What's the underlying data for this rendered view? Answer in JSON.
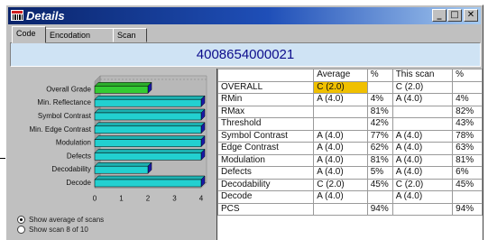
{
  "window": {
    "title": "Details",
    "buttons": {
      "minimize": "_",
      "maximize": "□",
      "close": "✕"
    }
  },
  "tabs": [
    {
      "label": "Code",
      "active": true
    },
    {
      "label": "Encodation",
      "active": false
    },
    {
      "label": "Scan",
      "active": false
    }
  ],
  "barcode_value": "4008654000021",
  "chart_data": {
    "type": "bar",
    "orientation": "horizontal",
    "style": "3d",
    "categories": [
      "Overall Grade",
      "Min. Reflectance",
      "Symbol Contrast",
      "Min. Edge Contrast",
      "Modulation",
      "Defects",
      "Decodability",
      "Decode"
    ],
    "values": [
      2,
      4,
      4,
      4,
      4,
      4,
      2,
      4
    ],
    "bar_colors": [
      "#33cc33",
      "#22d0d0",
      "#22d0d0",
      "#22d0d0",
      "#22d0d0",
      "#22d0d0",
      "#22d0d0",
      "#22d0d0"
    ],
    "xlim": [
      0,
      4
    ],
    "xticks": [
      "0",
      "1",
      "2",
      "3",
      "4"
    ],
    "title": "",
    "xlabel": "",
    "ylabel": ""
  },
  "scan_options": [
    {
      "label": "Show average of scans",
      "selected": true
    },
    {
      "label": "Show scan 8 of 10",
      "selected": false
    }
  ],
  "grid": {
    "headers": [
      "",
      "Average",
      "%",
      "This scan",
      "%"
    ],
    "rows": [
      {
        "name": "OVERALL",
        "avg": "C (2.0)",
        "pct1": "",
        "this": "C (2.0)",
        "pct2": "",
        "highlight": true
      },
      {
        "name": "RMin",
        "avg": "A (4.0)",
        "pct1": "4%",
        "this": "A (4.0)",
        "pct2": "4%"
      },
      {
        "name": "RMax",
        "avg": "",
        "pct1": "81%",
        "this": "",
        "pct2": "82%"
      },
      {
        "name": "Threshold",
        "avg": "",
        "pct1": "42%",
        "this": "",
        "pct2": "43%"
      },
      {
        "name": "Symbol Contrast",
        "avg": "A (4.0)",
        "pct1": "77%",
        "this": "A (4.0)",
        "pct2": "78%"
      },
      {
        "name": "Edge Contrast",
        "avg": "A (4.0)",
        "pct1": "62%",
        "this": "A (4.0)",
        "pct2": "63%"
      },
      {
        "name": "Modulation",
        "avg": "A (4.0)",
        "pct1": "81%",
        "this": "A (4.0)",
        "pct2": "81%"
      },
      {
        "name": "Defects",
        "avg": "A (4.0)",
        "pct1": "5%",
        "this": "A (4.0)",
        "pct2": "6%"
      },
      {
        "name": "Decodability",
        "avg": "C (2.0)",
        "pct1": "45%",
        "this": "C (2.0)",
        "pct2": "45%"
      },
      {
        "name": "Decode",
        "avg": "A (4.0)",
        "pct1": "",
        "this": "A (4.0)",
        "pct2": ""
      },
      {
        "name": "PCS",
        "avg": "",
        "pct1": "94%",
        "this": "",
        "pct2": "94%"
      }
    ]
  }
}
